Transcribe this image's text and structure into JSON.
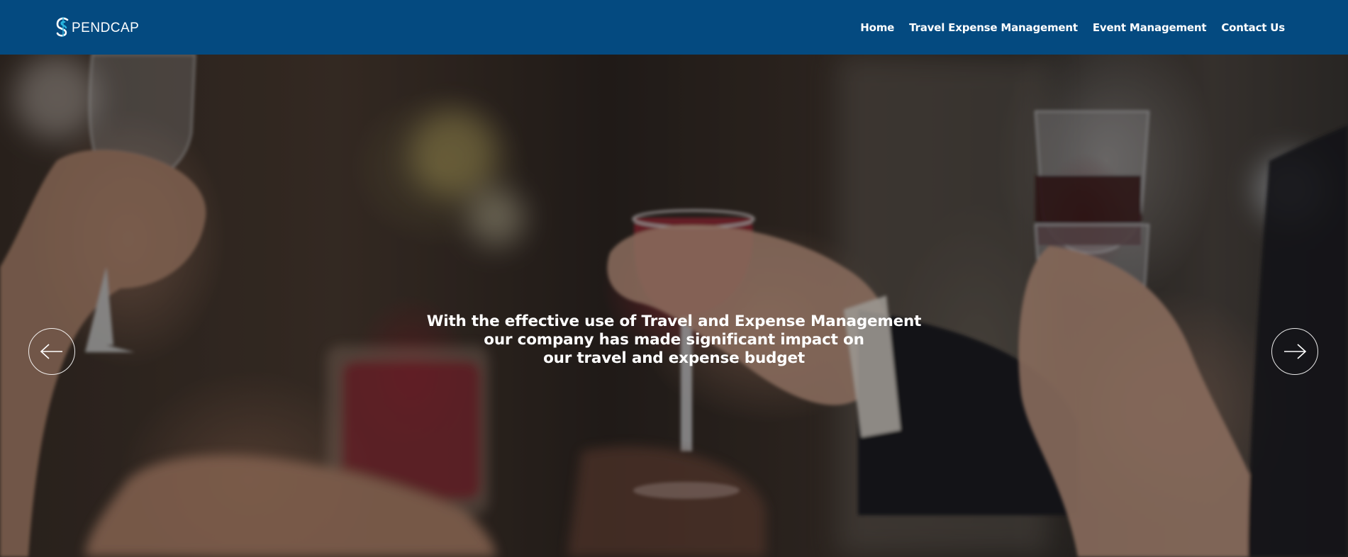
{
  "brand": {
    "logo_letter": "S",
    "logo_text": "PENDCAP",
    "color_primary": "#044a80",
    "color_accent": "#29b6e0"
  },
  "nav": {
    "items": [
      {
        "label": "Home"
      },
      {
        "label": "Travel Expense Management"
      },
      {
        "label": "Event Management"
      },
      {
        "label": "Contact Us"
      }
    ]
  },
  "hero": {
    "caption_lines": [
      "With the effective use of Travel and Expense Management",
      "our company has made significant impact on",
      "our travel and expense budget"
    ],
    "prev_icon": "arrow-left-icon",
    "next_icon": "arrow-right-icon"
  }
}
